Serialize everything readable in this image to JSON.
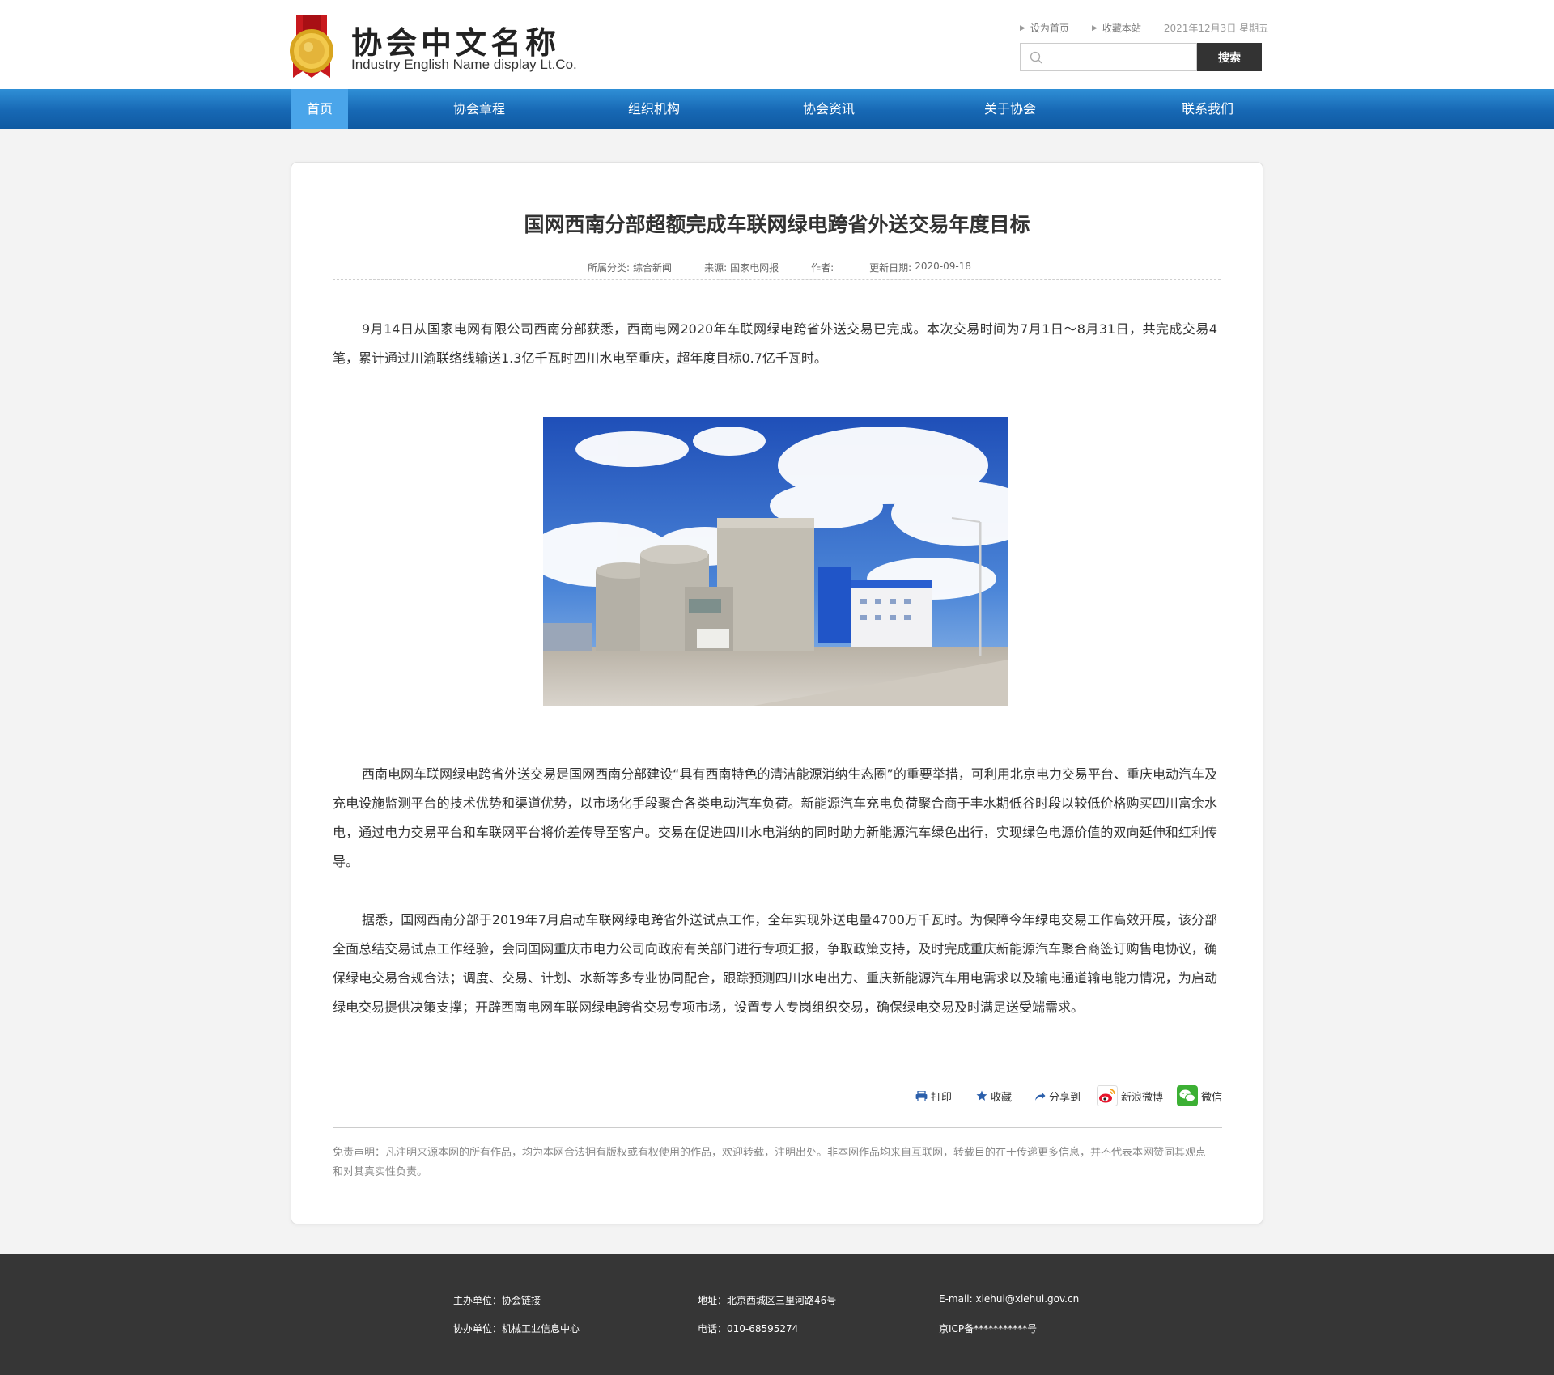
{
  "header": {
    "logo_cn": "协会中文名称",
    "logo_en": "Industry English Name display Lt.Co.",
    "links": [
      "设为首页",
      "收藏本站"
    ],
    "date": "2021年12月3日 星期五",
    "search_placeholder": "",
    "search_button": "搜索"
  },
  "nav": {
    "items": [
      "首页",
      "协会章程",
      "组织机构",
      "协会资讯",
      "关于协会",
      "联系我们"
    ],
    "active_index": 0
  },
  "article": {
    "title": "国网西南分部超额完成车联网绿电跨省外送交易年度目标",
    "meta": {
      "category_label": "所属分类:",
      "category": "综合新闻",
      "source_label": "来源:",
      "source": "国家电网报",
      "author_label": "作者:",
      "author": "",
      "date_label": "更新日期:",
      "date": "2020-09-18"
    },
    "paragraphs": [
      "9月14日从国家电网有限公司西南分部获悉，西南电网2020年车联网绿电跨省外送交易已完成。本次交易时间为7月1日～8月31日，共完成交易4笔，累计通过川渝联络线输送1.3亿千瓦时四川水电至重庆，超年度目标0.7亿千瓦时。",
      "西南电网车联网绿电跨省外送交易是国网西南分部建设“具有西南特色的清洁能源消纳生态圈”的重要举措，可利用北京电力交易平台、重庆电动汽车及充电设施监测平台的技术优势和渠道优势，以市场化手段聚合各类电动汽车负荷。新能源汽车充电负荷聚合商于丰水期低谷时段以较低价格购买四川富余水电，通过电力交易平台和车联网平台将价差传导至客户。交易在促进四川水电消纳的同时助力新能源汽车绿色出行，实现绿色电源价值的双向延伸和红利传导。",
      "据悉，国网西南分部于2019年7月启动车联网绿电跨省外送试点工作，全年实现外送电量4700万千瓦时。为保障今年绿电交易工作高效开展，该分部全面总结交易试点工作经验，会同国网重庆市电力公司向政府有关部门进行专项汇报，争取政策支持，及时完成重庆新能源汽车聚合商签订购售电协议，确保绿电交易合规合法；调度、交易、计划、水新等多专业协同配合，跟踪预测四川水电出力、重庆新能源汽车用电需求以及输电通道输电能力情况，为启动绿电交易提供决策支撑；开辟西南电网车联网绿电跨省交易专项市场，设置专人专岗组织交易，确保绿电交易及时满足送受端需求。"
    ],
    "share": {
      "print": "打印",
      "favorite": "收藏",
      "share_to": "分享到",
      "weibo": "新浪微博",
      "wechat": "微信"
    },
    "disclaimer": "免责声明：凡注明来源本网的所有作品，均为本网合法拥有版权或有权使用的作品，欢迎转载，注明出处。非本网作品均来自互联网，转载目的在于传递更多信息，并不代表本网赞同其观点和对其真实性负责。"
  },
  "footer": {
    "host": "主办单位：协会链接",
    "co_host": "协办单位：机械工业信息中心",
    "address": "地址：北京西城区三里河路46号",
    "phone": "电话：010-68595274",
    "email": "E-mail: xiehui@xiehui.gov.cn",
    "icp": "京ICP备***********号"
  },
  "colors": {
    "nav_blue": "#1768b4",
    "nav_active": "#4aa5ea",
    "footer_bg": "#363636",
    "search_btn": "#333333"
  },
  "icons": [
    "medal-logo-icon",
    "search-icon",
    "printer-icon",
    "star-icon",
    "share-arrow-icon",
    "weibo-icon",
    "wechat-icon"
  ]
}
